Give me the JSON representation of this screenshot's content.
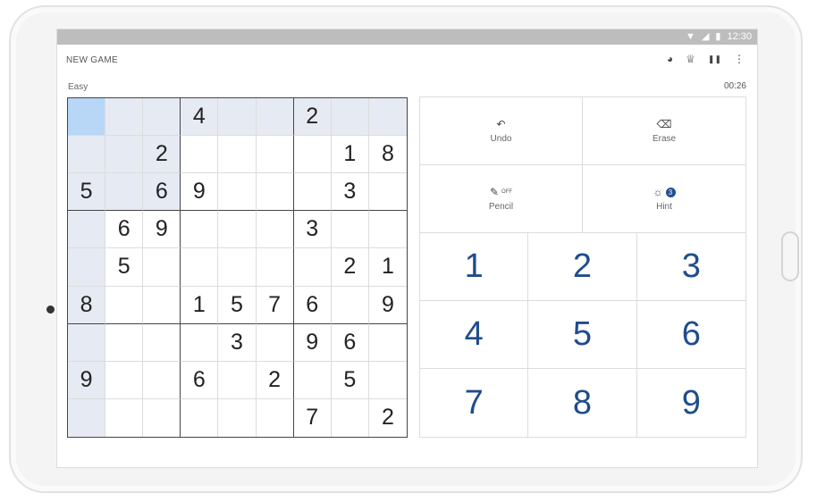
{
  "statusbar": {
    "time": "12:30",
    "wifi_icon": "▼",
    "signal_icon": "◢",
    "battery_icon": "▮"
  },
  "appbar": {
    "new_game_label": "NEW GAME",
    "actions": [
      {
        "name": "palette-icon",
        "glyph": "◕"
      },
      {
        "name": "trophy-icon",
        "glyph": "♕"
      },
      {
        "name": "pause-icon",
        "glyph": "❚❚"
      },
      {
        "name": "more-icon",
        "glyph": "⋮"
      }
    ]
  },
  "game": {
    "difficulty": "Easy",
    "timer": "00:26"
  },
  "board": {
    "rows": [
      [
        "",
        "",
        "",
        "4",
        "",
        "",
        "2",
        "",
        ""
      ],
      [
        "",
        "",
        "2",
        "",
        "",
        "",
        "",
        "1",
        "8"
      ],
      [
        "5",
        "",
        "6",
        "9",
        "",
        "",
        "",
        "3",
        ""
      ],
      [
        "",
        "6",
        "9",
        "",
        "",
        "",
        "3",
        "",
        ""
      ],
      [
        "",
        "5",
        "",
        "",
        "",
        "",
        "",
        "2",
        "1"
      ],
      [
        "8",
        "",
        "",
        "1",
        "5",
        "7",
        "6",
        "",
        "9"
      ],
      [
        "",
        "",
        "",
        "",
        "3",
        "",
        "9",
        "6",
        ""
      ],
      [
        "9",
        "",
        "",
        "6",
        "",
        "2",
        "",
        "5",
        ""
      ],
      [
        "",
        "",
        "",
        "",
        "",
        "",
        "7",
        "",
        "2"
      ]
    ],
    "selected": {
      "row": 0,
      "col": 0
    },
    "colors": {
      "selected": "#b8d6f5",
      "highlight": "#e6eaf2"
    }
  },
  "tools": {
    "undo": {
      "label": "Undo",
      "icon": "↶"
    },
    "erase": {
      "label": "Erase",
      "icon": "⌫"
    },
    "pencil": {
      "label": "Pencil",
      "icon": "✎",
      "state": "OFF"
    },
    "hint": {
      "label": "Hint",
      "icon": "☼",
      "count": "3"
    }
  },
  "numpad": [
    "1",
    "2",
    "3",
    "4",
    "5",
    "6",
    "7",
    "8",
    "9"
  ],
  "accent_color": "#1f4c8c"
}
